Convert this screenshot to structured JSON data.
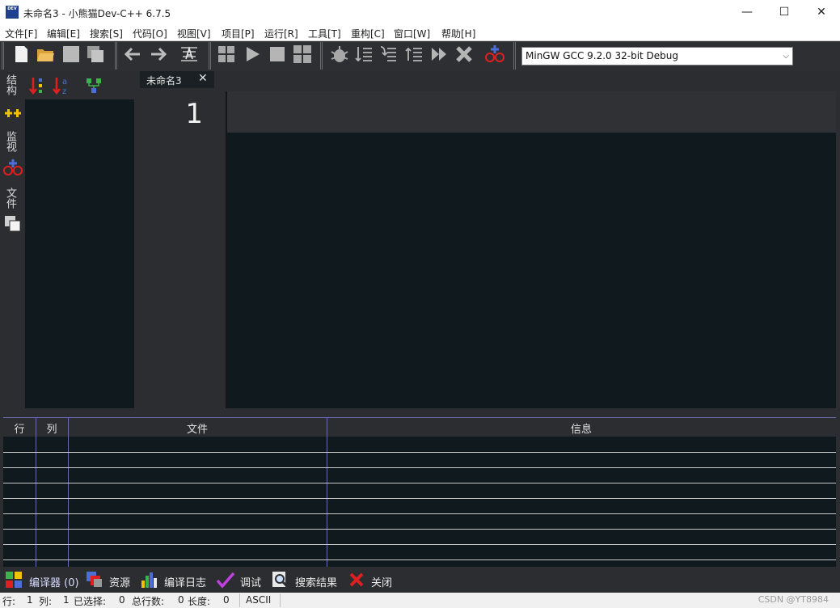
{
  "window": {
    "icon_text": "DEV",
    "title": "未命名3 - 小熊猫Dev-C++ 6.7.5",
    "minimize": "—",
    "maximize": "☐",
    "close": "✕"
  },
  "menu": [
    "文件[F]",
    "编辑[E]",
    "搜索[S]",
    "代码[O]",
    "视图[V]",
    "项目[P]",
    "运行[R]",
    "工具[T]",
    "重构[C]",
    "窗口[W]",
    "帮助[H]"
  ],
  "toolbar": {
    "compiler": "MinGW GCC 9.2.0 32-bit Debug",
    "icons": [
      "new-file",
      "open-folder",
      "save",
      "save-all",
      "back-arrow",
      "forward-arrow",
      "format-code",
      "compile",
      "run",
      "stop",
      "compile-run",
      "debug",
      "step-over",
      "step-into",
      "step-out",
      "continue",
      "stop-debug",
      "add-watch"
    ]
  },
  "side_tabs": [
    "结构",
    "监视",
    "文件"
  ],
  "editor": {
    "tab_title": "未命名3",
    "tab_close": "✕",
    "line_number": "1"
  },
  "messages": {
    "columns": [
      "行",
      "列",
      "文件",
      "信息"
    ],
    "rows": []
  },
  "bottom_tabs": [
    {
      "label": "编译器 (0)",
      "icon": "compiler-grid-icon"
    },
    {
      "label": "资源",
      "icon": "resource-icon"
    },
    {
      "label": "编译日志",
      "icon": "bar-chart-icon"
    },
    {
      "label": "调试",
      "icon": "checkmark-icon"
    },
    {
      "label": "搜索结果",
      "icon": "search-result-icon"
    },
    {
      "label": "关闭",
      "icon": "close-red-icon"
    }
  ],
  "status": {
    "line_label": "行:",
    "line_value": "1",
    "col_label": "列:",
    "col_value": "1",
    "selected_label": "已选择:",
    "selected_value": "0",
    "total_lines_label": "总行数:",
    "total_lines_value": "0",
    "length_label": "长度:",
    "length_value": "0",
    "encoding": "ASCII",
    "watermark": "CSDN @YT8984"
  },
  "colors": {
    "editor_bg": "#0f191e",
    "panel_bg": "#2b2d30",
    "accent_blue": "#4a6fd8",
    "close_red": "#e02020"
  }
}
